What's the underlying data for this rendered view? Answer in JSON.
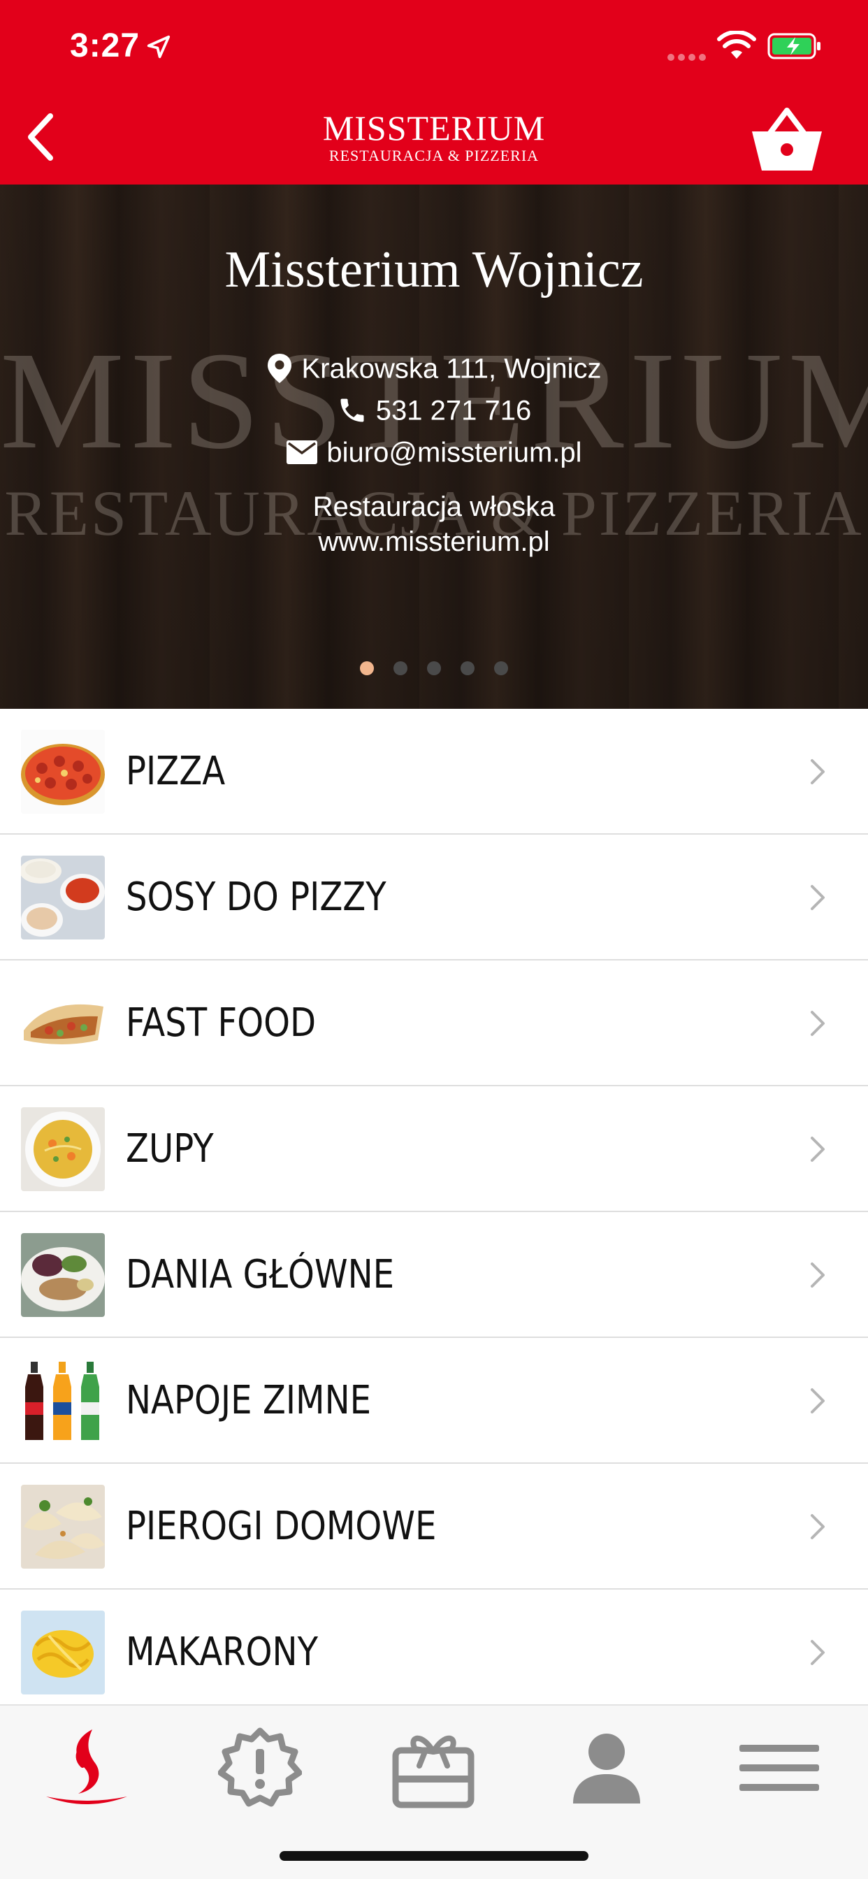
{
  "status_bar": {
    "time": "3:27"
  },
  "header": {
    "brand_name": "MISSTERIUM",
    "brand_sub": "RESTAURACJA & PIZZERIA"
  },
  "hero": {
    "title": "Missterium Wojnicz",
    "address": "Krakowska  111, Wojnicz",
    "phone": "531 271 716",
    "email": "biuro@missterium.pl",
    "description": "Restauracja włoska",
    "website": "www.missterium.pl",
    "watermark_top": "MISSTERIUM",
    "watermark_bottom": "RESTAURACJA & PIZZERIA",
    "pager_count": 5,
    "pager_active": 1
  },
  "categories": [
    {
      "label": "PIZZA",
      "icon": "pizza-thumbnail"
    },
    {
      "label": "SOSY DO PIZZY",
      "icon": "sauces-thumbnail"
    },
    {
      "label": "FAST FOOD",
      "icon": "wrap-thumbnail"
    },
    {
      "label": "ZUPY",
      "icon": "soup-thumbnail"
    },
    {
      "label": "DANIA GŁÓWNE",
      "icon": "main-dish-thumbnail"
    },
    {
      "label": "NAPOJE ZIMNE",
      "icon": "drinks-thumbnail"
    },
    {
      "label": "PIEROGI DOMOWE",
      "icon": "dumplings-thumbnail"
    },
    {
      "label": "MAKARONY",
      "icon": "pasta-thumbnail"
    }
  ],
  "tabbar": {
    "tabs": [
      "home",
      "promotions",
      "gift",
      "profile",
      "menu"
    ],
    "active": "home"
  },
  "colors": {
    "brand_red": "#e2001a",
    "pager_active": "#f2b68e",
    "tab_inactive": "#8c8c8c"
  }
}
